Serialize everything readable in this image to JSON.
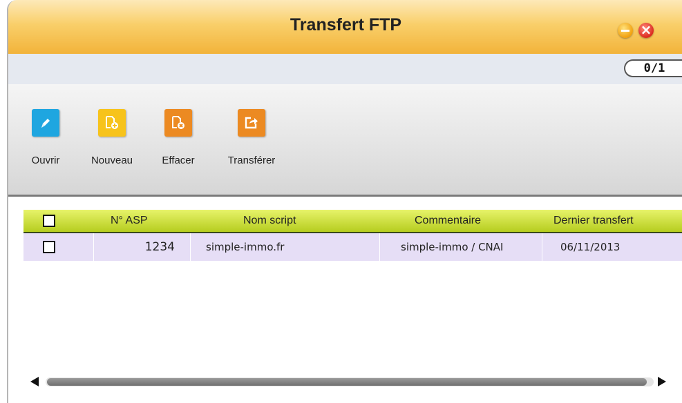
{
  "window": {
    "title": "Transfert FTP",
    "counter": "0/1"
  },
  "toolbar": {
    "buttons": [
      {
        "label": "Ouvrir",
        "icon": "pencil-icon",
        "color": "#1fa6e0"
      },
      {
        "label": "Nouveau",
        "icon": "new-document-icon",
        "color": "#f7c31b"
      },
      {
        "label": "Effacer",
        "icon": "delete-document-icon",
        "color": "#ec8a22"
      },
      {
        "label": "Transférer",
        "icon": "export-icon",
        "color": "#ec8a22"
      }
    ]
  },
  "table": {
    "columns": [
      "N° ASP",
      "Nom script",
      "Commentaire",
      "Dernier transfert"
    ],
    "rows": [
      {
        "asp": "1234",
        "script": "simple-immo.fr",
        "comment": "simple-immo / CNAI",
        "last_transfer": "06/11/2013",
        "checked": false
      }
    ]
  },
  "colors": {
    "title_bar": "#f2b33a",
    "header_row": "#c8dc2e",
    "selected_row": "#e6def6"
  }
}
